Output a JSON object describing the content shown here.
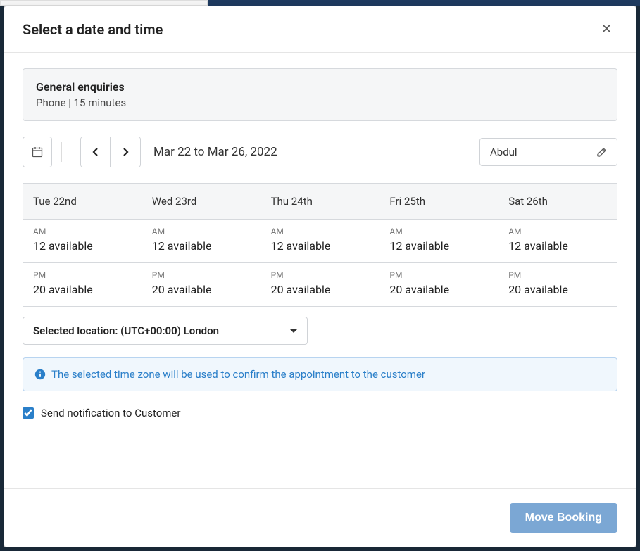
{
  "modal": {
    "title": "Select a date and time"
  },
  "service": {
    "name": "General enquiries",
    "details": "Phone | 15 minutes"
  },
  "toolbar": {
    "date_range": "Mar 22 to Mar 26, 2022",
    "staff": "Abdul"
  },
  "days": [
    {
      "label": "Tue 22nd",
      "am_period": "AM",
      "am_count": "12 available",
      "pm_period": "PM",
      "pm_count": "20 available"
    },
    {
      "label": "Wed 23rd",
      "am_period": "AM",
      "am_count": "12 available",
      "pm_period": "PM",
      "pm_count": "20 available"
    },
    {
      "label": "Thu 24th",
      "am_period": "AM",
      "am_count": "12 available",
      "pm_period": "PM",
      "pm_count": "20 available"
    },
    {
      "label": "Fri 25th",
      "am_period": "AM",
      "am_count": "12 available",
      "pm_period": "PM",
      "pm_count": "20 available"
    },
    {
      "label": "Sat 26th",
      "am_period": "AM",
      "am_count": "12 available",
      "pm_period": "PM",
      "pm_count": "20 available"
    }
  ],
  "timezone": {
    "label": "Selected location: (UTC+00:00) London"
  },
  "info": {
    "message": "The selected time zone will be used to confirm the appointment to the customer"
  },
  "notify": {
    "label": "Send notification to Customer",
    "checked": true
  },
  "footer": {
    "move_label": "Move Booking"
  }
}
